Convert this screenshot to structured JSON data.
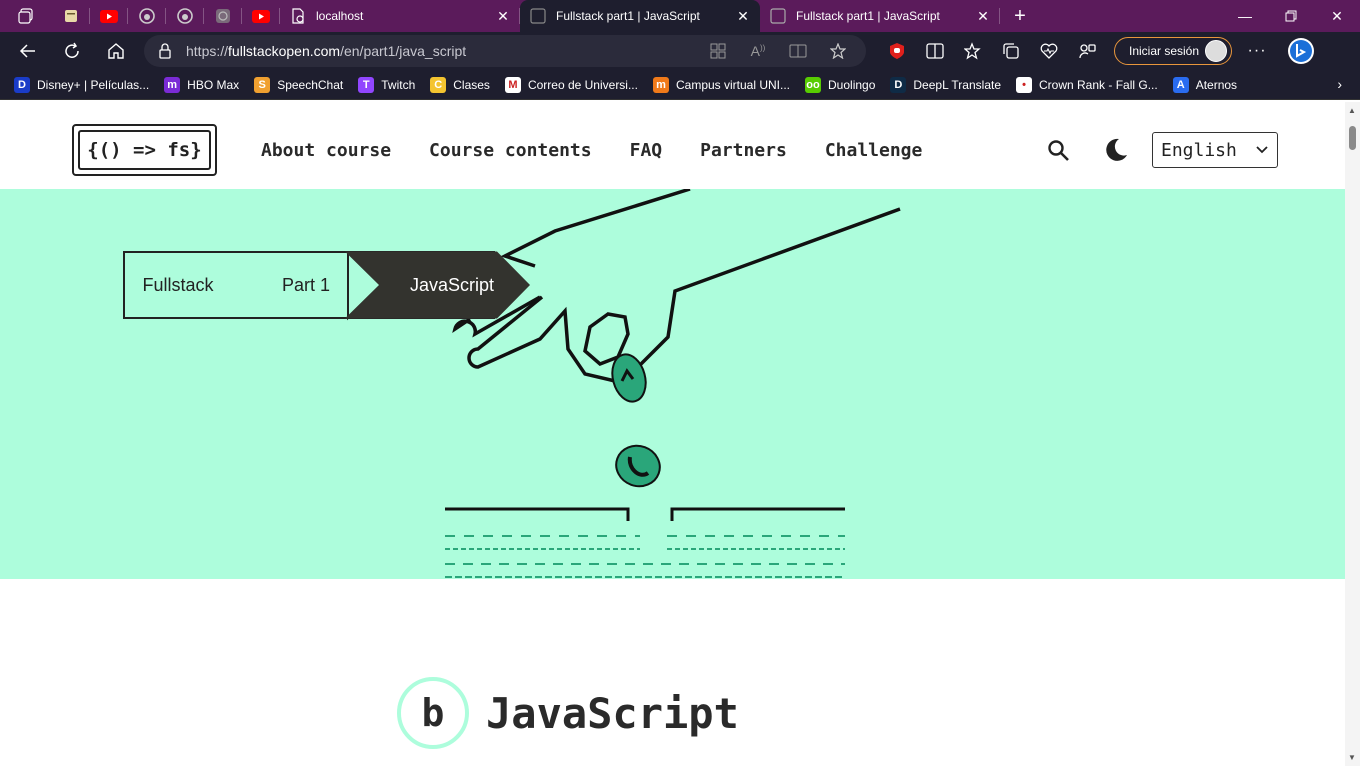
{
  "browser": {
    "tabs": [
      {
        "title": "localhost",
        "active": false
      },
      {
        "title": "Fullstack part1 | JavaScript",
        "active": true
      },
      {
        "title": "Fullstack part1 | JavaScript",
        "active": false
      }
    ],
    "url_prefix": "https://",
    "url_host": "fullstackopen.com",
    "url_path": "/en/part1/java_script",
    "signin_label": "Iniciar sesión",
    "bookmarks": [
      {
        "label": "Disney+ | Películas...",
        "color": "#1a3cc8",
        "glyph": "D"
      },
      {
        "label": "HBO Max",
        "color": "#7b2bd6",
        "glyph": "m"
      },
      {
        "label": "SpeechChat",
        "color": "#f0a030",
        "glyph": "S"
      },
      {
        "label": "Twitch",
        "color": "#9146ff",
        "glyph": "T"
      },
      {
        "label": "Clases",
        "color": "#f4c430",
        "glyph": "C"
      },
      {
        "label": "Correo de Universi...",
        "color": "#ffffff",
        "glyph": "M"
      },
      {
        "label": "Campus virtual UNI...",
        "color": "#f07a1a",
        "glyph": "m"
      },
      {
        "label": "Duolingo",
        "color": "#58cc02",
        "glyph": "oo"
      },
      {
        "label": "DeepL Translate",
        "color": "#0f2b46",
        "glyph": "D"
      },
      {
        "label": "Crown Rank - Fall G...",
        "color": "#ffffff",
        "glyph": "•"
      },
      {
        "label": "Aternos",
        "color": "#2a6cf0",
        "glyph": "A"
      }
    ]
  },
  "site": {
    "logo": "{() => fs}",
    "nav": [
      "About course",
      "Course contents",
      "FAQ",
      "Partners",
      "Challenge"
    ],
    "language": "English",
    "accent_color": "#adfddc",
    "breadcrumbs": [
      "Fullstack",
      "Part 1",
      "JavaScript"
    ],
    "section_letter": "b",
    "section_title": "JavaScript"
  }
}
